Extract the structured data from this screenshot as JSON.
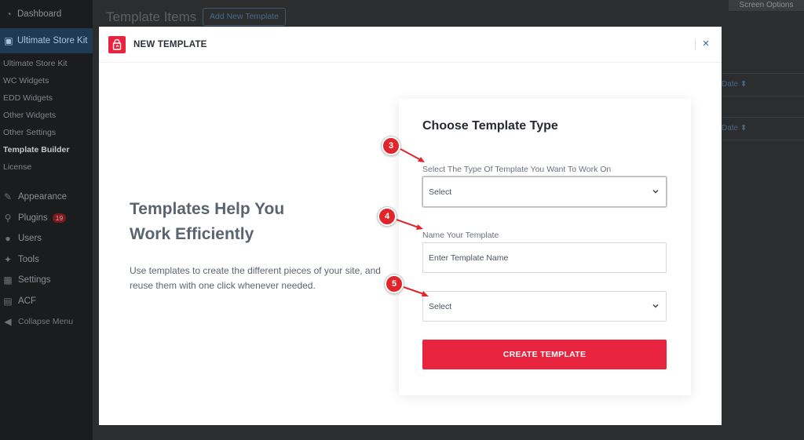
{
  "sidebar": {
    "top_item": "Dashboard",
    "active_item": "Ultimate Store Kit",
    "submenu": [
      "Ultimate Store Kit",
      "WC Widgets",
      "EDD Widgets",
      "Other Widgets",
      "Other Settings",
      "Template Builder",
      "License"
    ],
    "current_submenu": "Template Builder",
    "menu": [
      {
        "label": "Appearance",
        "icon": "paintbrush-icon"
      },
      {
        "label": "Plugins",
        "icon": "plugin-icon",
        "badge": "19"
      },
      {
        "label": "Users",
        "icon": "users-icon"
      },
      {
        "label": "Tools",
        "icon": "wrench-icon"
      },
      {
        "label": "Settings",
        "icon": "settings-icon"
      },
      {
        "label": "ACF",
        "icon": "acf-icon"
      },
      {
        "label": "Collapse Menu",
        "icon": "collapse-icon"
      }
    ]
  },
  "background": {
    "page_title": "Template Items",
    "add_button": "Add New Template",
    "screen_options": "Screen Options",
    "date_col_1": "Date",
    "date_col_2": "Date"
  },
  "modal": {
    "title": "NEW TEMPLATE",
    "close_symbol": "×",
    "left_heading_1": "Templates Help You",
    "left_heading_2": "Work Efficiently",
    "left_desc": "Use templates to create the different pieces of your site, and reuse them with one click whenever needed.",
    "form": {
      "heading": "Choose Template Type",
      "type_label": "Select The Type Of Template You Want To Work On",
      "type_value": "Select",
      "name_label": "Name Your Template",
      "name_placeholder": "Enter Template Name",
      "third_value": "Select",
      "submit_label": "CREATE TEMPLATE"
    }
  },
  "annotations": [
    "3",
    "4",
    "5"
  ],
  "colors": {
    "accent": "#e8243f",
    "marker": "#e0252b",
    "sidebar_bg": "#1b1c1e",
    "overlay_bg": "#2b2d2f"
  }
}
